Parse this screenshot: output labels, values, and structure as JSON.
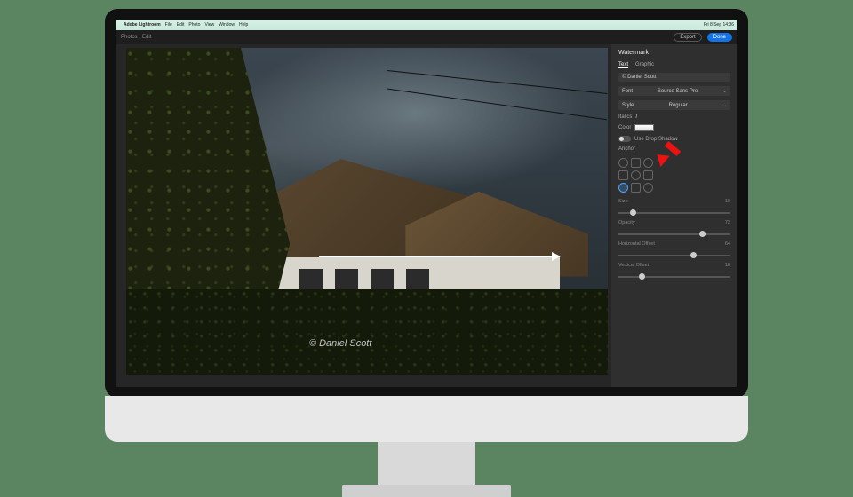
{
  "mac_menu": {
    "apple": "",
    "app_name": "Adobe Lightroom",
    "items": [
      "File",
      "Edit",
      "Photo",
      "View",
      "Window",
      "Help"
    ],
    "status_right": "Fri 8 Sep 14:36"
  },
  "app_bar": {
    "breadcrumb": "Photos  ›  Edit",
    "export_label": "Export",
    "done_label": "Done"
  },
  "photo": {
    "watermark_text": "© Daniel Scott"
  },
  "panel": {
    "title": "Watermark",
    "tabs": {
      "text": "Text",
      "graphic": "Graphic",
      "active_index": 0
    },
    "copyright_name_label": "© Daniel Scott",
    "font": {
      "label": "Font",
      "value": "Source Sans Pro"
    },
    "style": {
      "label": "Style",
      "value": "Regular"
    },
    "italics_label": "Italics",
    "color_label": "Color",
    "drop_shadow_label": "Use Drop Shadow",
    "anchor_label": "Anchor",
    "anchor_selected_index": 6,
    "sliders": {
      "size": {
        "label": "Size",
        "value": 10,
        "min": 0,
        "max": 100
      },
      "opacity": {
        "label": "Opacity",
        "value": 72,
        "min": 0,
        "max": 100
      },
      "horizontal": {
        "label": "Horizontal Offset",
        "value": 64,
        "min": 0,
        "max": 100
      },
      "vertical": {
        "label": "Vertical Offset",
        "value": 18,
        "min": 0,
        "max": 100
      }
    }
  },
  "annotation": {
    "red_arrow_target": "anchor-grid"
  }
}
